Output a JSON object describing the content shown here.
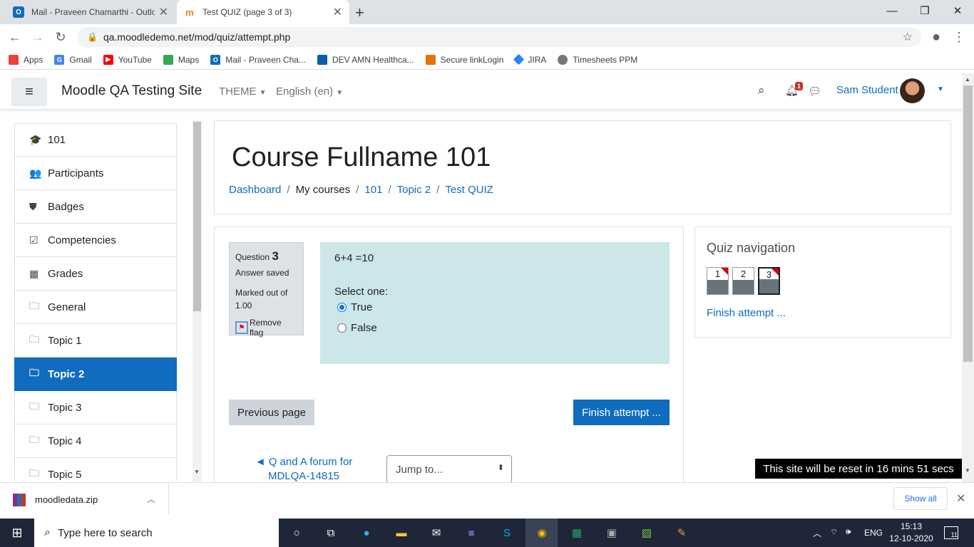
{
  "browser": {
    "tabs": [
      {
        "title": "Mail - Praveen Chamarthi - Outlo",
        "favicon_color": "#0f6cbd"
      },
      {
        "title": "Test QUIZ (page 3 of 3)",
        "favicon_color": "#f98012"
      }
    ],
    "url": "qa.moodledemo.net/mod/quiz/attempt.php",
    "bookmarks": [
      {
        "label": "Apps",
        "color": "#ea4335"
      },
      {
        "label": "Gmail",
        "color": "#4285f4"
      },
      {
        "label": "YouTube",
        "color": "#ff0000"
      },
      {
        "label": "Maps",
        "color": "#34a853"
      },
      {
        "label": "Mail - Praveen Cha...",
        "color": "#0f6cbd"
      },
      {
        "label": "DEV AMN Healthca...",
        "color": "#0b5ea8"
      },
      {
        "label": "Secure linkLogin",
        "color": "#e8710a"
      },
      {
        "label": "JIRA",
        "color": "#2684ff"
      },
      {
        "label": "Timesheets PPM",
        "color": "#777777"
      }
    ]
  },
  "navbar": {
    "site_name": "Moodle QA Testing Site",
    "theme_label": "THEME",
    "language_label": "English (en)",
    "notification_count": "1",
    "user_name": "Sam Student"
  },
  "sidebar": {
    "items": [
      {
        "label": "101",
        "icon": "graduation-cap-icon",
        "glyph": "🎓"
      },
      {
        "label": "Participants",
        "icon": "users-icon",
        "glyph": "👥"
      },
      {
        "label": "Badges",
        "icon": "shield-icon",
        "glyph": "⛊"
      },
      {
        "label": "Competencies",
        "icon": "check-square-icon",
        "glyph": "☑"
      },
      {
        "label": "Grades",
        "icon": "table-icon",
        "glyph": "▦"
      },
      {
        "label": "General",
        "icon": "folder-icon",
        "glyph": "🗀"
      },
      {
        "label": "Topic 1",
        "icon": "folder-icon",
        "glyph": "🗀"
      },
      {
        "label": "Topic 2",
        "icon": "folder-icon",
        "glyph": "🗀"
      },
      {
        "label": "Topic 3",
        "icon": "folder-icon",
        "glyph": "🗀"
      },
      {
        "label": "Topic 4",
        "icon": "folder-icon",
        "glyph": "🗀"
      },
      {
        "label": "Topic 5",
        "icon": "folder-icon",
        "glyph": "🗀"
      }
    ],
    "active_item": "Topic 2"
  },
  "header": {
    "course_title": "Course Fullname 101",
    "breadcrumb": [
      "Dashboard",
      "My courses",
      "101",
      "Topic 2",
      "Test QUIZ"
    ]
  },
  "question": {
    "label": "Question",
    "number": "3",
    "state": "Answer saved",
    "marks": "Marked out of 1.00",
    "flag_label": "Remove flag",
    "text": "6+4 =10",
    "prompt": "Select one:",
    "options": [
      {
        "label": "True",
        "selected": true
      },
      {
        "label": "False",
        "selected": false
      }
    ]
  },
  "actions": {
    "previous_label": "Previous page",
    "finish_label": "Finish attempt ...",
    "prev_activity_label": "◄ Q and A forum for MDLQA-14815",
    "jump_placeholder": "Jump to..."
  },
  "quiz_nav": {
    "title": "Quiz navigation",
    "buttons": [
      {
        "number": "1",
        "flagged": true,
        "current": false
      },
      {
        "number": "2",
        "flagged": false,
        "current": false
      },
      {
        "number": "3",
        "flagged": true,
        "current": true
      }
    ],
    "finish_link": "Finish attempt ..."
  },
  "reset_notice": "This site will be reset in 16 mins 51 secs",
  "download": {
    "filename": "moodledata.zip",
    "show_all": "Show all"
  },
  "taskbar": {
    "search_placeholder": "Type here to search",
    "language": "ENG",
    "time": "15:13",
    "date": "12-10-2020",
    "notification_count": "11"
  },
  "colors": {
    "primary": "#0f6cbf",
    "question_bg": "#cce6ea",
    "flag": "#dd0000"
  }
}
